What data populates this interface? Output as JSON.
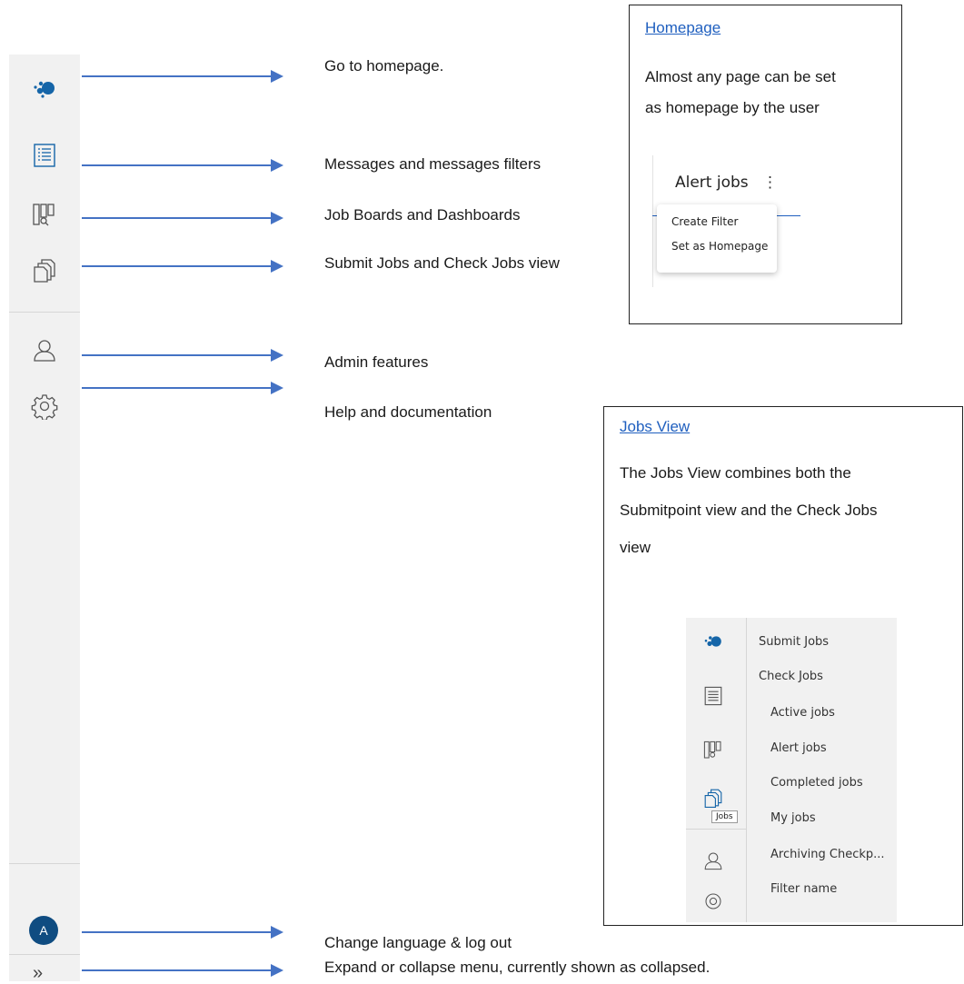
{
  "sidebar": {
    "icons": [
      "logo-icon",
      "messages-list-icon",
      "job-boards-icon",
      "jobs-copy-icon",
      "user-icon",
      "gear-icon"
    ],
    "avatar_letter": "A",
    "expand_glyph": "»"
  },
  "annotations": {
    "homepage": "Go to homepage.",
    "messages": "Messages and messages filters",
    "boards": "Job Boards and Dashboards",
    "jobs": "Submit Jobs and Check Jobs view",
    "admin": "Admin features",
    "help": "Help and documentation",
    "language": "Change language & log out",
    "expand": "Expand or collapse menu, currently shown as collapsed."
  },
  "homepage_callout": {
    "link": "Homepage",
    "text_line1": "Almost any page can be set",
    "text_line2": "as homepage by the user",
    "header": "Alert jobs",
    "kebab": "⋮",
    "menu_items": [
      "Create Filter",
      "Set as Homepage"
    ]
  },
  "jobs_callout": {
    "link": "Jobs View",
    "text_line1": "The Jobs View combines both the",
    "text_line2": "Submitpoint view and the Check Jobs",
    "text_line3": "view",
    "menu": [
      "Submit Jobs",
      "Check Jobs",
      "Active jobs",
      "Alert jobs",
      "Completed jobs",
      "My jobs",
      "Archiving Checkp...",
      "Filter name"
    ],
    "tooltip": "Jobs"
  },
  "colors": {
    "arrow": "#4472c4",
    "accent": "#0f4c81",
    "link": "#1f5fbf"
  }
}
